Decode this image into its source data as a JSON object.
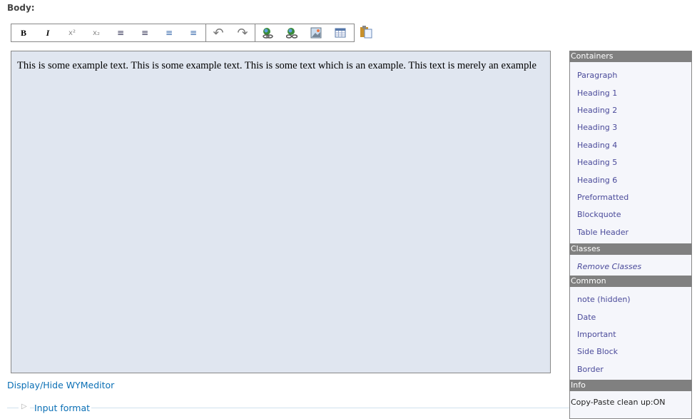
{
  "field_label": "Body:",
  "toolbar": {
    "groups": [
      [
        {
          "name": "bold",
          "label": "B"
        },
        {
          "name": "italic",
          "label": "I"
        },
        {
          "name": "superscript",
          "label": "x²"
        },
        {
          "name": "subscript",
          "label": "x₂"
        },
        {
          "name": "ordered-list",
          "label": "≡"
        },
        {
          "name": "unordered-list",
          "label": "≡"
        },
        {
          "name": "indent",
          "label": "≡"
        },
        {
          "name": "outdent",
          "label": "≡"
        }
      ],
      [
        {
          "name": "undo",
          "label": "↶"
        },
        {
          "name": "redo",
          "label": "↷"
        }
      ],
      [
        {
          "name": "link",
          "label": ""
        },
        {
          "name": "unlink",
          "label": ""
        },
        {
          "name": "image",
          "label": ""
        },
        {
          "name": "table",
          "label": ""
        }
      ]
    ]
  },
  "editor": {
    "text": "This is some example text. This is some example text. This is some text which is an example. This text is merely an example"
  },
  "panel": {
    "containers_title": "Containers",
    "containers": [
      "Paragraph",
      "Heading 1",
      "Heading 2",
      "Heading 3",
      "Heading 4",
      "Heading 5",
      "Heading 6",
      "Preformatted",
      "Blockquote",
      "Table Header"
    ],
    "classes_title": "Classes",
    "remove_classes": "Remove Classes",
    "common_title": "Common",
    "common": [
      "note (hidden)",
      "Date",
      "Important",
      "Side Block",
      "Border"
    ],
    "info_title": "Info",
    "info_text": "Copy-Paste clean up:ON"
  },
  "toggle_link": "Display/Hide WYMeditor",
  "input_format": "Input format"
}
